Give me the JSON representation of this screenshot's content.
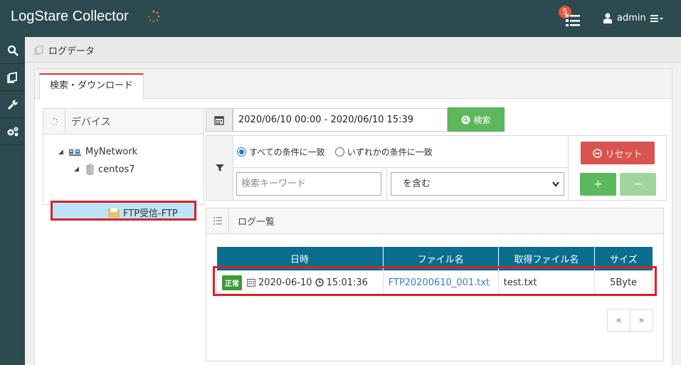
{
  "app": {
    "title": "LogStare Collector"
  },
  "header": {
    "task_count": "5",
    "user": "admin"
  },
  "sidebar": {
    "items": [
      {
        "icon": "search-icon"
      },
      {
        "icon": "logs-icon"
      },
      {
        "icon": "wrench-icon"
      },
      {
        "icon": "gears-icon"
      }
    ]
  },
  "breadcrumb": {
    "label": "ログデータ"
  },
  "tabs": [
    {
      "label": "検索・ダウンロード",
      "active": true
    }
  ],
  "devices": {
    "title": "デバイス",
    "tree": {
      "root": "MyNetwork",
      "host": "centos7",
      "selected": "FTP受信-FTP"
    }
  },
  "search": {
    "date_range": "2020/06/10 00:00 - 2020/06/10 15:39",
    "button": "検索"
  },
  "filter": {
    "match_all": "すべての条件に一致",
    "match_any": "いずれかの条件に一致",
    "keyword_placeholder": "検索キーワード",
    "operator": "を含む",
    "reset": "リセット",
    "add": "+",
    "remove": "−"
  },
  "loglist": {
    "title": "ログ一覧",
    "columns": [
      "日時",
      "ファイル名",
      "取得ファイル名",
      "サイズ"
    ],
    "rows": [
      {
        "status": "正常",
        "date": "2020-06-10",
        "time": "15:01:36",
        "file": "FTP20200610_001.txt",
        "fetched": "test.txt",
        "size": "5Byte"
      }
    ],
    "prev": "«",
    "next": "»"
  },
  "colors": {
    "accent_red": "#d4232a",
    "header_bg": "#2c4a4f",
    "table_head": "#0b6e8d",
    "green": "#5cb85c"
  }
}
